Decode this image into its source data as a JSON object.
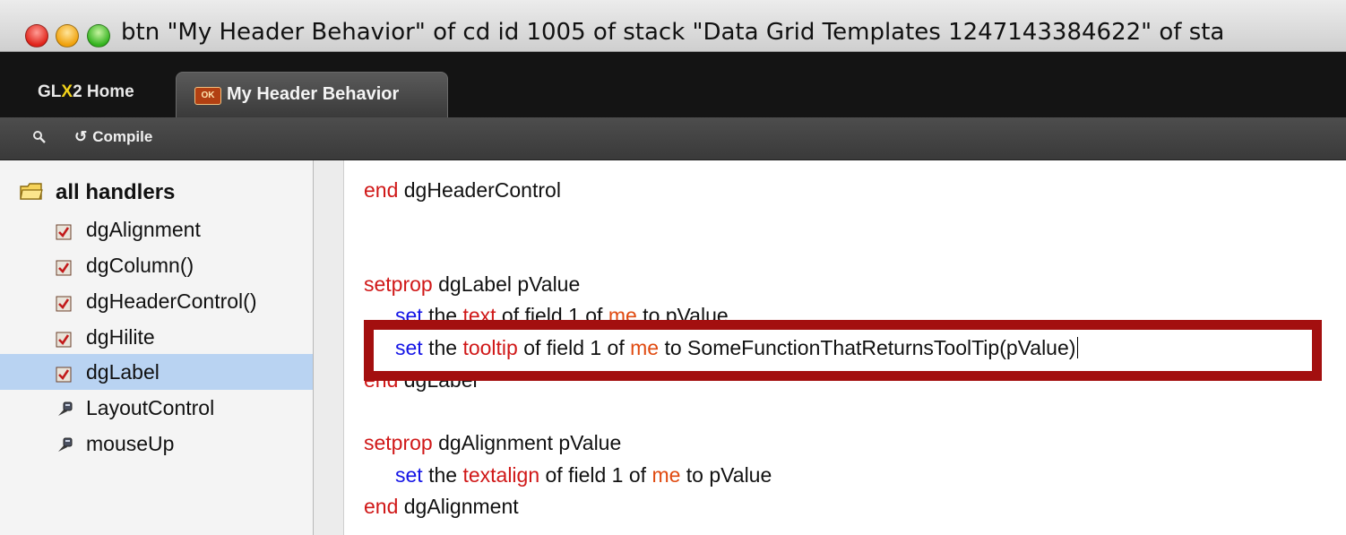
{
  "window": {
    "title": "btn \"My Header Behavior\" of cd id 1005 of stack \"Data Grid Templates 1247143384622\" of sta"
  },
  "tabs": {
    "home": {
      "prefix": "GL",
      "highlight": "X",
      "suffix": "2 Home"
    },
    "active": {
      "label": "My Header Behavior",
      "icon": "ok-badge-icon",
      "icon_text": "OK"
    }
  },
  "toolbar": {
    "search_icon": "magnifier-icon",
    "compile_label": "Compile",
    "compile_icon": "compile-arrow-icon"
  },
  "sidebar": {
    "root_label": "all handlers",
    "items": [
      {
        "label": "dgAlignment",
        "icon": "property-icon"
      },
      {
        "label": "dgColumn()",
        "icon": "property-icon"
      },
      {
        "label": "dgHeaderControl()",
        "icon": "property-icon"
      },
      {
        "label": "dgHilite",
        "icon": "property-icon"
      },
      {
        "label": "dgLabel",
        "icon": "property-icon"
      },
      {
        "label": "LayoutControl",
        "icon": "handler-icon"
      },
      {
        "label": "mouseUp",
        "icon": "handler-icon"
      }
    ],
    "selected": "dgLabel"
  },
  "editor": {
    "line1": {
      "a": "end",
      "b": " dgHeaderControl"
    },
    "line2": {
      "a": "setprop",
      "b": " dgLabel pValue"
    },
    "line3": {
      "a": "set",
      "b": " the ",
      "c": "text",
      "d": " of field 1 of ",
      "e": "me",
      "f": " to pValue"
    },
    "line4": {
      "a": "set",
      "b": " the ",
      "c": "tooltip",
      "d": " of field 1 of ",
      "e": "me",
      "f": " to SomeFunctionThatReturnsToolTip(pValue)"
    },
    "line5": {
      "a": "end",
      "b": " dgLabel"
    },
    "line6": {
      "a": "setprop",
      "b": " dgAlignment pValue"
    },
    "line7": {
      "a": "set",
      "b": " the ",
      "c": "textalign",
      "d": " of field 1 of ",
      "e": "me",
      "f": " to pValue"
    },
    "line8": {
      "a": "end",
      "b": " dgAlignment"
    }
  },
  "colors": {
    "keyword_red": "#d01818",
    "keyword_blue": "#1414e6",
    "keyword_orange": "#e04a10",
    "highlight_border": "#a30f0f",
    "selection": "#b9d3f2"
  }
}
